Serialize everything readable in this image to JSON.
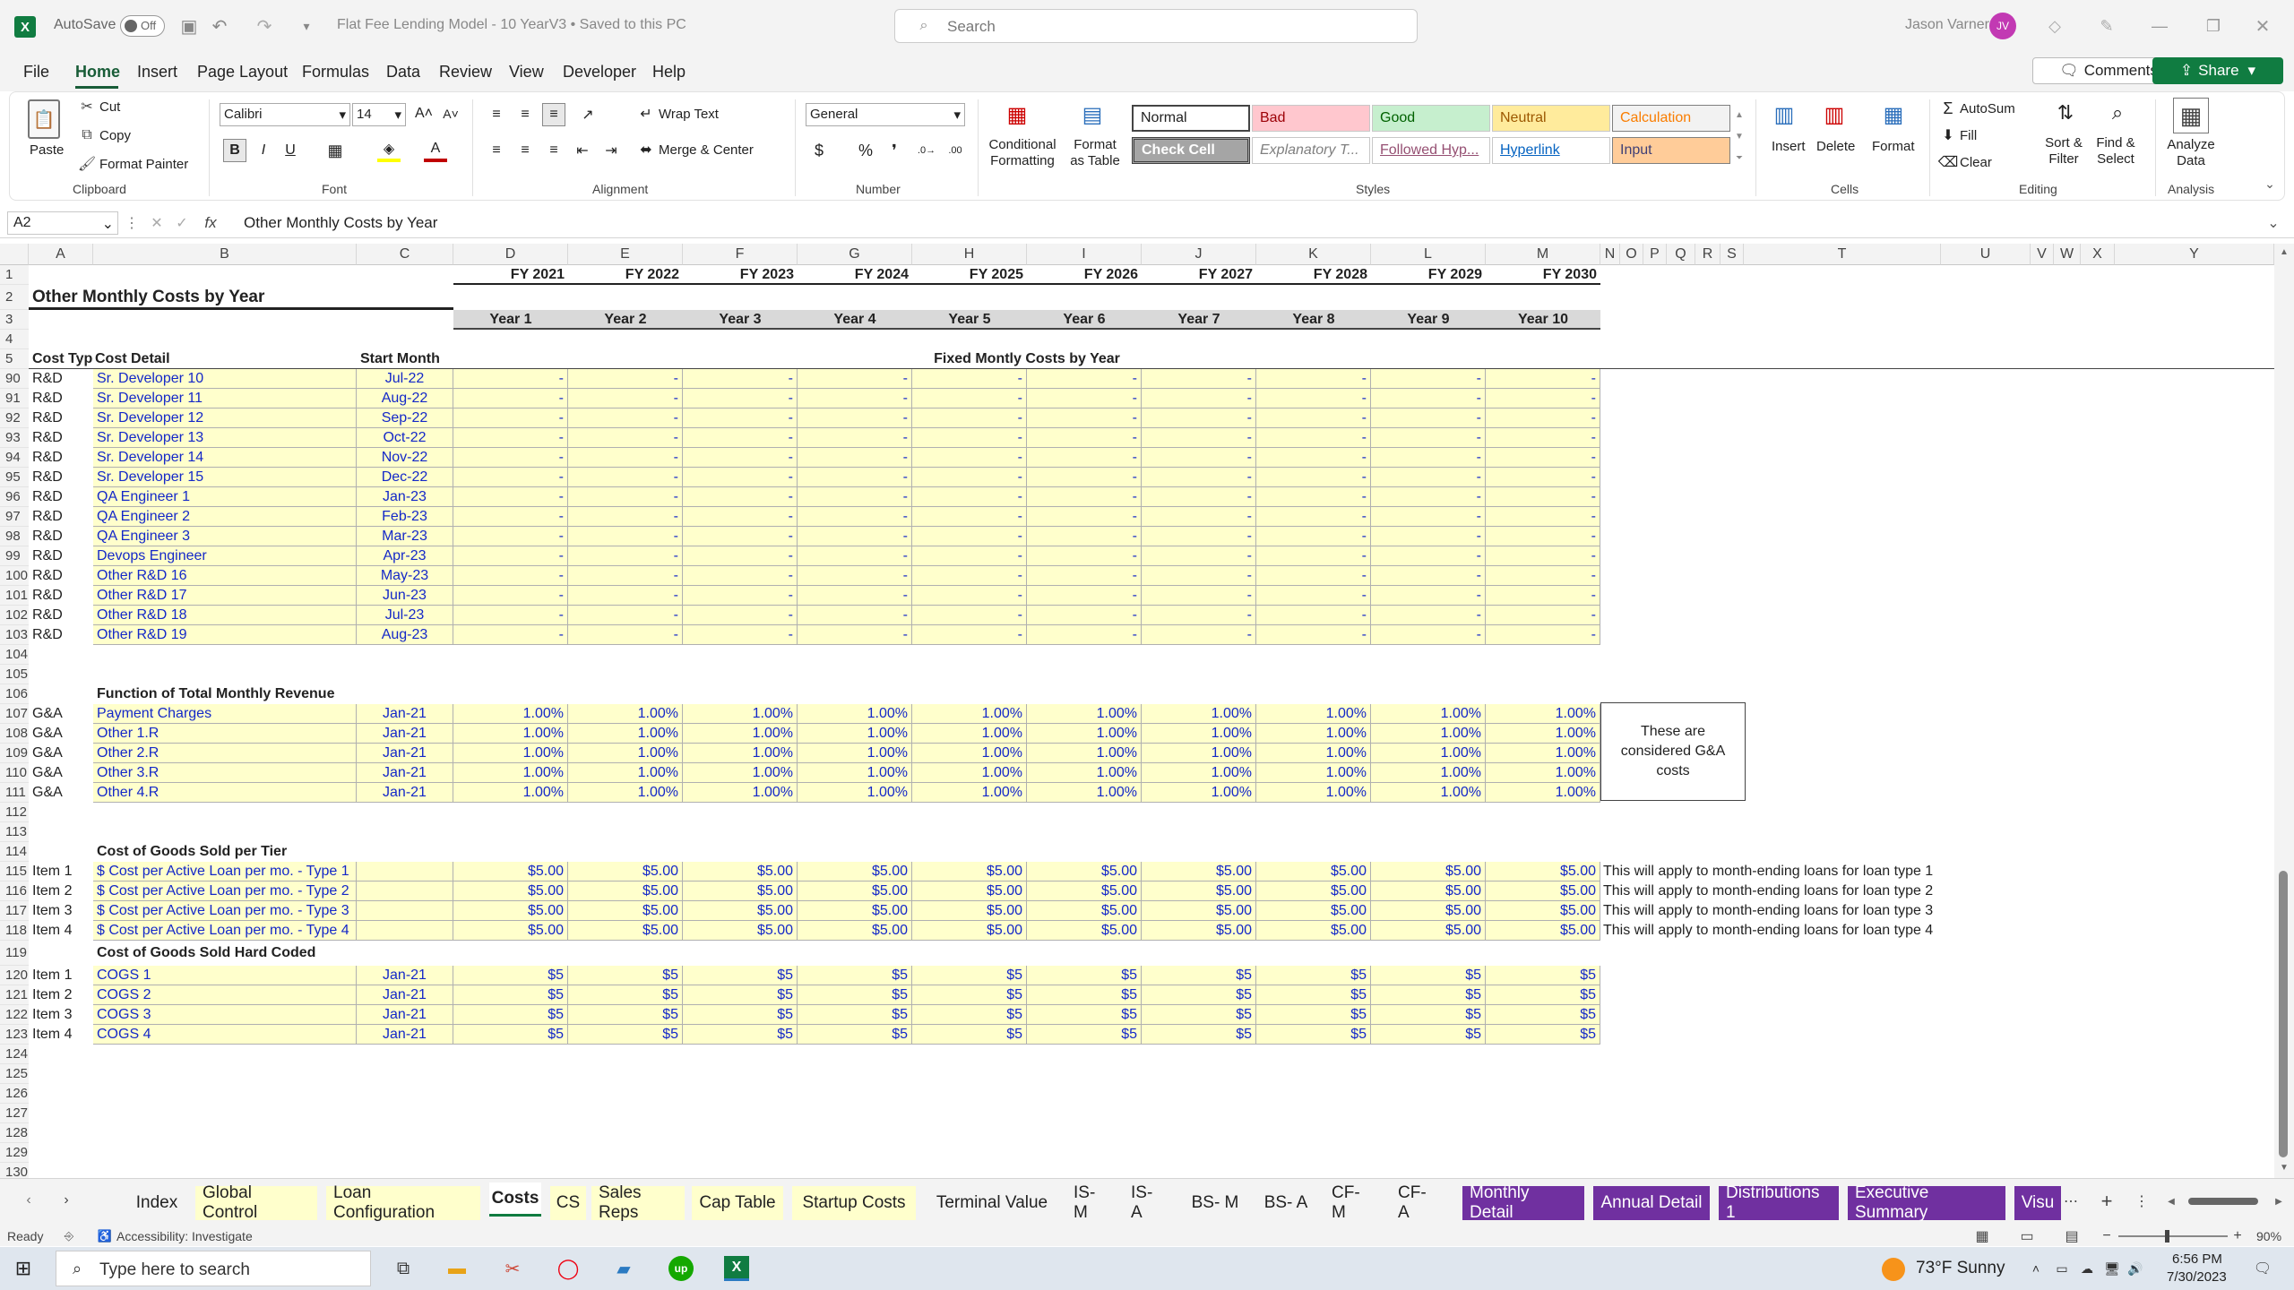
{
  "titlebar": {
    "autosave": "AutoSave",
    "autosave_state": "Off",
    "doc_title": "Flat Fee Lending Model - 10 YearV3 • Saved to this PC",
    "search": "Search",
    "user": "Jason Varner",
    "initials": "JV"
  },
  "menu": [
    "File",
    "Home",
    "Insert",
    "Page Layout",
    "Formulas",
    "Data",
    "Review",
    "View",
    "Developer",
    "Help"
  ],
  "comments": "Comments",
  "share": "Share",
  "ribbon": {
    "clipboard": {
      "paste": "Paste",
      "cut": "Cut",
      "copy": "Copy",
      "format_painter": "Format Painter",
      "label": "Clipboard"
    },
    "font": {
      "name": "Calibri",
      "size": "14",
      "label": "Font"
    },
    "alignment": {
      "wrap": "Wrap Text",
      "merge": "Merge & Center",
      "label": "Alignment"
    },
    "number": {
      "format": "General",
      "label": "Number"
    },
    "styles": {
      "cond": "Conditional Formatting",
      "table": "Format as Table",
      "label": "Styles",
      "items": [
        [
          "Normal",
          "Bad",
          "Good",
          "Neutral",
          "Calculation"
        ],
        [
          "Check Cell",
          "Explanatory T...",
          "Followed Hyp...",
          "Hyperlink",
          "Input"
        ]
      ]
    },
    "cells": {
      "insert": "Insert",
      "delete": "Delete",
      "format": "Format",
      "label": "Cells"
    },
    "editing": {
      "autosum": "AutoSum",
      "fill": "Fill",
      "clear": "Clear",
      "sort": "Sort & Filter",
      "find": "Find & Select",
      "label": "Editing"
    },
    "analysis": {
      "analyze": "Analyze Data",
      "label": "Analysis"
    }
  },
  "formula": {
    "namebox": "A2",
    "content": "Other Monthly Costs by Year"
  },
  "columns": [
    "A",
    "B",
    "C",
    "D",
    "E",
    "F",
    "G",
    "H",
    "I",
    "J",
    "K",
    "L",
    "M",
    "N",
    "O",
    "P",
    "Q",
    "R",
    "S",
    "T",
    "U",
    "V",
    "W",
    "X",
    "Y"
  ],
  "header": {
    "fy": [
      "FY 2021",
      "FY 2022",
      "FY 2023",
      "FY 2024",
      "FY 2025",
      "FY 2026",
      "FY 2027",
      "FY 2028",
      "FY 2029",
      "FY 2030"
    ],
    "years": [
      "Year 1",
      "Year 2",
      "Year 3",
      "Year 4",
      "Year 5",
      "Year 6",
      "Year 7",
      "Year 8",
      "Year 9",
      "Year 10"
    ],
    "title": "Other Monthly Costs by Year",
    "cost_type": "Cost Type",
    "cost_detail": "Cost Detail",
    "start_month": "Start Month",
    "fixed": "Fixed Montly Costs by Year"
  },
  "rows": [
    {
      "n": "1"
    },
    {
      "n": "2"
    },
    {
      "n": "3"
    },
    {
      "n": "4"
    },
    {
      "n": "5"
    },
    {
      "n": "90",
      "a": "R&D",
      "b": "Sr. Developer 10",
      "c": "Jul-22",
      "v": "-"
    },
    {
      "n": "91",
      "a": "R&D",
      "b": "Sr. Developer 11",
      "c": "Aug-22",
      "v": "-"
    },
    {
      "n": "92",
      "a": "R&D",
      "b": "Sr. Developer 12",
      "c": "Sep-22",
      "v": "-"
    },
    {
      "n": "93",
      "a": "R&D",
      "b": "Sr. Developer 13",
      "c": "Oct-22",
      "v": "-"
    },
    {
      "n": "94",
      "a": "R&D",
      "b": "Sr. Developer 14",
      "c": "Nov-22",
      "v": "-"
    },
    {
      "n": "95",
      "a": "R&D",
      "b": "Sr. Developer 15",
      "c": "Dec-22",
      "v": "-"
    },
    {
      "n": "96",
      "a": "R&D",
      "b": "QA Engineer 1",
      "c": "Jan-23",
      "v": "-"
    },
    {
      "n": "97",
      "a": "R&D",
      "b": "QA Engineer 2",
      "c": "Feb-23",
      "v": "-"
    },
    {
      "n": "98",
      "a": "R&D",
      "b": "QA Engineer 3",
      "c": "Mar-23",
      "v": "-"
    },
    {
      "n": "99",
      "a": "R&D",
      "b": "Devops Engineer",
      "c": "Apr-23",
      "v": "-"
    },
    {
      "n": "100",
      "a": "R&D",
      "b": "Other R&D 16",
      "c": "May-23",
      "v": "-"
    },
    {
      "n": "101",
      "a": "R&D",
      "b": "Other R&D 17",
      "c": "Jun-23",
      "v": "-"
    },
    {
      "n": "102",
      "a": "R&D",
      "b": "Other R&D 18",
      "c": "Jul-23",
      "v": "-"
    },
    {
      "n": "103",
      "a": "R&D",
      "b": "Other R&D 19",
      "c": "Aug-23",
      "v": "-"
    },
    {
      "n": "104"
    },
    {
      "n": "105"
    },
    {
      "n": "106",
      "h": "Function of Total Monthly Revenue"
    },
    {
      "n": "107",
      "a": "G&A",
      "b": "Payment Charges",
      "c": "Jan-21",
      "v": "1.00%"
    },
    {
      "n": "108",
      "a": "G&A",
      "b": "Other 1.R",
      "c": "Jan-21",
      "v": "1.00%"
    },
    {
      "n": "109",
      "a": "G&A",
      "b": "Other 2.R",
      "c": "Jan-21",
      "v": "1.00%"
    },
    {
      "n": "110",
      "a": "G&A",
      "b": "Other 3.R",
      "c": "Jan-21",
      "v": "1.00%"
    },
    {
      "n": "111",
      "a": "G&A",
      "b": "Other 4.R",
      "c": "Jan-21",
      "v": "1.00%"
    },
    {
      "n": "112"
    },
    {
      "n": "113"
    },
    {
      "n": "114",
      "h": "Cost of Goods Sold per Tier"
    },
    {
      "n": "115",
      "a": "Item 1",
      "b": "$ Cost per Active Loan per mo. - Type 1",
      "v": "$5.00",
      "note": "This will apply to month-ending loans for loan type 1"
    },
    {
      "n": "116",
      "a": "Item 2",
      "b": "$ Cost per Active Loan per mo. - Type 2",
      "v": "$5.00",
      "note": "This will apply to month-ending loans for loan type 2"
    },
    {
      "n": "117",
      "a": "Item 3",
      "b": "$ Cost per Active Loan per mo. - Type 3",
      "v": "$5.00",
      "note": "This will apply to month-ending loans for loan type 3"
    },
    {
      "n": "118",
      "a": "Item 4",
      "b": "$ Cost per Active Loan per mo. - Type 4",
      "v": "$5.00",
      "note": "This will apply to month-ending loans for loan type 4"
    },
    {
      "n": "119",
      "h": "Cost of Goods Sold Hard Coded"
    },
    {
      "n": "120",
      "a": "Item 1",
      "b": "COGS 1",
      "c": "Jan-21",
      "v": "$5"
    },
    {
      "n": "121",
      "a": "Item 2",
      "b": "COGS 2",
      "c": "Jan-21",
      "v": "$5"
    },
    {
      "n": "122",
      "a": "Item 3",
      "b": "COGS 3",
      "c": "Jan-21",
      "v": "$5"
    },
    {
      "n": "123",
      "a": "Item 4",
      "b": "COGS 4",
      "c": "Jan-21",
      "v": "$5"
    },
    {
      "n": "124"
    },
    {
      "n": "125"
    },
    {
      "n": "126"
    },
    {
      "n": "127"
    },
    {
      "n": "128"
    },
    {
      "n": "129"
    },
    {
      "n": "130"
    }
  ],
  "ga_note": "These are considered G&A costs",
  "sheets": [
    {
      "label": "Index",
      "bg": "#f3f3f3",
      "fg": "#222"
    },
    {
      "label": "Global Control",
      "bg": "#ffffcc",
      "fg": "#222"
    },
    {
      "label": "Loan Configuration",
      "bg": "#ffffcc",
      "fg": "#222"
    },
    {
      "label": "Costs",
      "bg": "#ffffff",
      "fg": "#222",
      "active": true
    },
    {
      "label": "CS",
      "bg": "#ffffcc",
      "fg": "#222"
    },
    {
      "label": "Sales Reps",
      "bg": "#ffffcc",
      "fg": "#222"
    },
    {
      "label": "Cap Table",
      "bg": "#ffffcc",
      "fg": "#222"
    },
    {
      "label": "Startup Costs",
      "bg": "#ffffcc",
      "fg": "#222"
    },
    {
      "label": "Terminal Value",
      "bg": "#f3f3f3",
      "fg": "#222"
    },
    {
      "label": "IS- M",
      "bg": "#f3f3f3",
      "fg": "#222"
    },
    {
      "label": "IS- A",
      "bg": "#f3f3f3",
      "fg": "#222"
    },
    {
      "label": "BS- M",
      "bg": "#f3f3f3",
      "fg": "#222"
    },
    {
      "label": "BS- A",
      "bg": "#f3f3f3",
      "fg": "#222"
    },
    {
      "label": "CF- M",
      "bg": "#f3f3f3",
      "fg": "#222"
    },
    {
      "label": "CF- A",
      "bg": "#f3f3f3",
      "fg": "#222"
    },
    {
      "label": "Monthly Detail",
      "bg": "#7030a0",
      "fg": "#ffffff"
    },
    {
      "label": "Annual Detail",
      "bg": "#7030a0",
      "fg": "#ffffff"
    },
    {
      "label": "Distributions 1",
      "bg": "#7030a0",
      "fg": "#ffffff"
    },
    {
      "label": "Executive Summary",
      "bg": "#7030a0",
      "fg": "#ffffff"
    },
    {
      "label": "Visu",
      "bg": "#7030a0",
      "fg": "#ffffff"
    }
  ],
  "status": {
    "ready": "Ready",
    "accessibility": "Accessibility: Investigate",
    "zoom": "90%"
  },
  "taskbar": {
    "search": "Type here to search",
    "weather": "73°F  Sunny",
    "time": "6:56 PM",
    "date": "7/30/2023"
  }
}
